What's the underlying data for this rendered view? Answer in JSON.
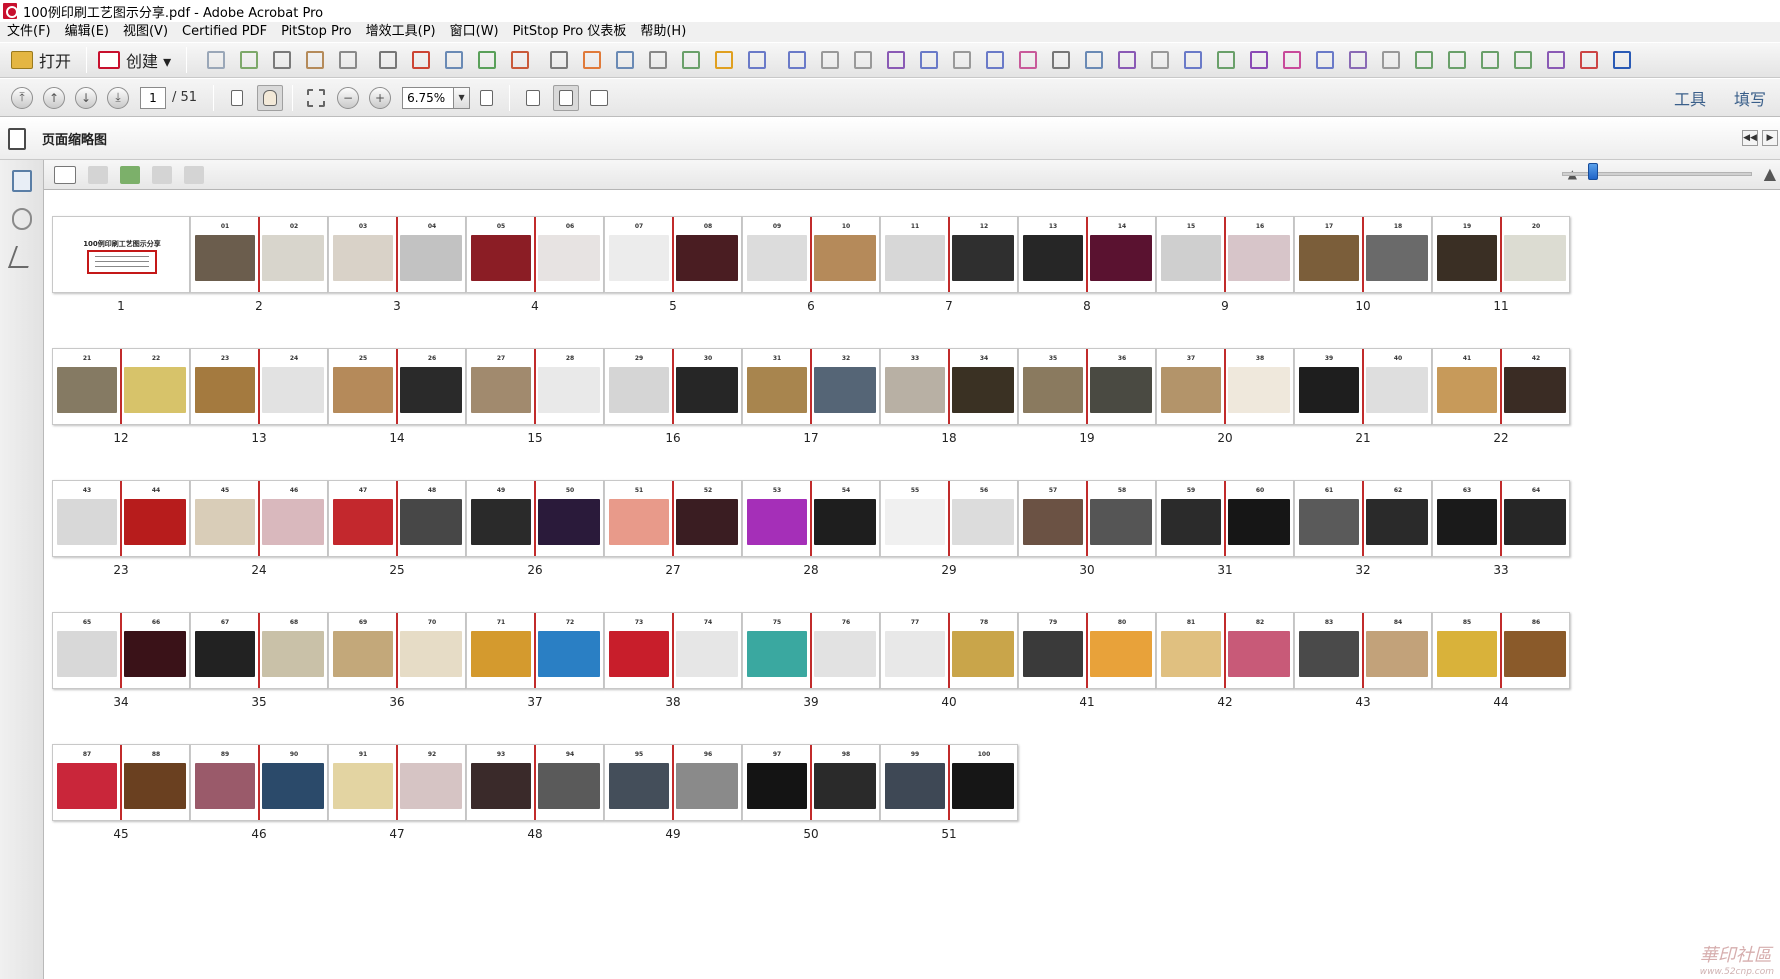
{
  "window": {
    "title": "100例印刷工艺图示分享.pdf - Adobe Acrobat Pro"
  },
  "menu": [
    "文件(F)",
    "编辑(E)",
    "视图(V)",
    "Certified PDF",
    "PitStop Pro",
    "增效工具(P)",
    "窗口(W)",
    "PitStop Pro 仪表板",
    "帮助(H)"
  ],
  "toolbar": {
    "open_label": "打开",
    "create_label": "创建 ▾",
    "icons": [
      "save-icon",
      "upload-icon",
      "print-icon",
      "edit-icon",
      "email-icon",
      "settings-icon",
      "pdf-delete-icon",
      "pdf-search-icon",
      "export-icon",
      "sign-icon",
      "print-setup-icon",
      "stamp-icon",
      "select-icon",
      "text-icon",
      "comment-icon",
      "color-bars-icon",
      "arrow-icon",
      "arrow-plus-icon",
      "crop-icon",
      "resize-icon",
      "preflight-icon",
      "move-icon",
      "split-icon",
      "annotate-icon",
      "link-icon",
      "screen-icon",
      "zoom-window-icon",
      "pin-icon",
      "ruler-icon",
      "list-icon",
      "checkbox-icon",
      "globe-icon",
      "gear-icon",
      "filter-icon",
      "funnel-icon",
      "grid-icon",
      "dots-icon",
      "hash-icon",
      "mail-x-icon",
      "pinwheel-icon",
      "warning-icon",
      "inspect-icon",
      "qs-icon"
    ]
  },
  "nav": {
    "current_page": "1",
    "total_pages": "/ 51",
    "zoom": "6.75%"
  },
  "right_tabs": [
    "工具",
    "填写"
  ],
  "panel": {
    "title": "页面缩略图"
  },
  "thumbnails": [
    {
      "label": "1",
      "cover": true,
      "cover_title": "100例印刷工艺图示分享"
    },
    {
      "label": "2",
      "h": [
        "01",
        "02"
      ],
      "c": [
        "#6b5d4d",
        "#d8d5cc"
      ]
    },
    {
      "label": "3",
      "h": [
        "03",
        "04"
      ],
      "c": [
        "#d9d2c8",
        "#c2c2c2"
      ]
    },
    {
      "label": "4",
      "h": [
        "05",
        "06"
      ],
      "c": [
        "#8b1d25",
        "#e7e3e2"
      ]
    },
    {
      "label": "5",
      "h": [
        "07",
        "08"
      ],
      "c": [
        "#ececec",
        "#4a1d22"
      ]
    },
    {
      "label": "6",
      "h": [
        "09",
        "10"
      ],
      "c": [
        "#dcdcdc",
        "#b58a5a"
      ]
    },
    {
      "label": "7",
      "h": [
        "11",
        "12"
      ],
      "c": [
        "#d7d7d7",
        "#2f2f2f"
      ]
    },
    {
      "label": "8",
      "h": [
        "13",
        "14"
      ],
      "c": [
        "#262626",
        "#5a1230"
      ]
    },
    {
      "label": "9",
      "h": [
        "15",
        "16"
      ],
      "c": [
        "#cfcfcf",
        "#d7c5c9"
      ]
    },
    {
      "label": "10",
      "h": [
        "17",
        "18"
      ],
      "c": [
        "#7b5e3a",
        "#6a6a6a"
      ]
    },
    {
      "label": "11",
      "h": [
        "19",
        "20"
      ],
      "c": [
        "#3a2f24",
        "#dcdcd2"
      ]
    },
    {
      "label": "12",
      "h": [
        "21",
        "22"
      ],
      "c": [
        "#857a63",
        "#d7c36a"
      ]
    },
    {
      "label": "13",
      "h": [
        "23",
        "24"
      ],
      "c": [
        "#a47a3f",
        "#e2e2e2"
      ]
    },
    {
      "label": "14",
      "h": [
        "25",
        "26"
      ],
      "c": [
        "#b58a5a",
        "#2a2a2a"
      ]
    },
    {
      "label": "15",
      "h": [
        "27",
        "28"
      ],
      "c": [
        "#a18a6e",
        "#e9e9e9"
      ]
    },
    {
      "label": "16",
      "h": [
        "29",
        "30"
      ],
      "c": [
        "#d5d5d5",
        "#262626"
      ]
    },
    {
      "label": "17",
      "h": [
        "31",
        "32"
      ],
      "c": [
        "#a8854e",
        "#556576"
      ]
    },
    {
      "label": "18",
      "h": [
        "33",
        "34"
      ],
      "c": [
        "#b8b0a4",
        "#3a3123"
      ]
    },
    {
      "label": "19",
      "h": [
        "35",
        "36"
      ],
      "c": [
        "#8a7a5f",
        "#4a4a42"
      ]
    },
    {
      "label": "20",
      "h": [
        "37",
        "38"
      ],
      "c": [
        "#b3946a",
        "#efe8dc"
      ]
    },
    {
      "label": "21",
      "h": [
        "39",
        "40"
      ],
      "c": [
        "#1e1e1e",
        "#dedede"
      ]
    },
    {
      "label": "22",
      "h": [
        "41",
        "42"
      ],
      "c": [
        "#c79a5a",
        "#3a2c24"
      ]
    },
    {
      "label": "23",
      "h": [
        "43",
        "44"
      ],
      "c": [
        "#d8d8d8",
        "#b71c1c"
      ]
    },
    {
      "label": "24",
      "h": [
        "45",
        "46"
      ],
      "c": [
        "#d9cdb8",
        "#d9b8bd"
      ]
    },
    {
      "label": "25",
      "h": [
        "47",
        "48"
      ],
      "c": [
        "#c3282d",
        "#474747"
      ]
    },
    {
      "label": "26",
      "h": [
        "49",
        "50"
      ],
      "c": [
        "#2a2a2a",
        "#2a1a3a"
      ]
    },
    {
      "label": "27",
      "h": [
        "51",
        "52"
      ],
      "c": [
        "#e89a8a",
        "#3a1d22"
      ]
    },
    {
      "label": "28",
      "h": [
        "53",
        "54"
      ],
      "c": [
        "#a52fb8",
        "#1e1e1e"
      ]
    },
    {
      "label": "29",
      "h": [
        "55",
        "56"
      ],
      "c": [
        "#f0f0f0",
        "#dcdcdc"
      ]
    },
    {
      "label": "30",
      "h": [
        "57",
        "58"
      ],
      "c": [
        "#6b5244",
        "#555555"
      ]
    },
    {
      "label": "31",
      "h": [
        "59",
        "60"
      ],
      "c": [
        "#2b2b2b",
        "#161616"
      ]
    },
    {
      "label": "32",
      "h": [
        "61",
        "62"
      ],
      "c": [
        "#5a5a5a",
        "#2a2a2a"
      ]
    },
    {
      "label": "33",
      "h": [
        "63",
        "64"
      ],
      "c": [
        "#1a1a1a",
        "#262626"
      ]
    },
    {
      "label": "34",
      "h": [
        "65",
        "66"
      ],
      "c": [
        "#d8d8d8",
        "#3a1218"
      ]
    },
    {
      "label": "35",
      "h": [
        "67",
        "68"
      ],
      "c": [
        "#222222",
        "#c9c1a8"
      ]
    },
    {
      "label": "36",
      "h": [
        "69",
        "70"
      ],
      "c": [
        "#c3a87a",
        "#e6dcc6"
      ]
    },
    {
      "label": "37",
      "h": [
        "71",
        "72"
      ],
      "c": [
        "#d49a2e",
        "#2a7fc4"
      ]
    },
    {
      "label": "38",
      "h": [
        "73",
        "74"
      ],
      "c": [
        "#c81e2b",
        "#e6e6e6"
      ]
    },
    {
      "label": "39",
      "h": [
        "75",
        "76"
      ],
      "c": [
        "#3aa8a0",
        "#e2e2e2"
      ]
    },
    {
      "label": "40",
      "h": [
        "77",
        "78"
      ],
      "c": [
        "#e8e8e8",
        "#c9a54a"
      ]
    },
    {
      "label": "41",
      "h": [
        "79",
        "80"
      ],
      "c": [
        "#3a3a3a",
        "#e8a23a"
      ]
    },
    {
      "label": "42",
      "h": [
        "81",
        "82"
      ],
      "c": [
        "#e0c080",
        "#c85a78"
      ]
    },
    {
      "label": "43",
      "h": [
        "83",
        "84"
      ],
      "c": [
        "#4a4a4a",
        "#c2a27a"
      ]
    },
    {
      "label": "44",
      "h": [
        "85",
        "86"
      ],
      "c": [
        "#d9b23a",
        "#8a5a2a"
      ]
    },
    {
      "label": "45",
      "h": [
        "87",
        "88"
      ],
      "c": [
        "#c9263a",
        "#6a4020"
      ]
    },
    {
      "label": "46",
      "h": [
        "89",
        "90"
      ],
      "c": [
        "#9a5a6a",
        "#2b4a6a"
      ]
    },
    {
      "label": "47",
      "h": [
        "91",
        "92"
      ],
      "c": [
        "#e3d4a2",
        "#d6c4c4"
      ]
    },
    {
      "label": "48",
      "h": [
        "93",
        "94"
      ],
      "c": [
        "#3a2a2a",
        "#5a5a5a"
      ]
    },
    {
      "label": "49",
      "h": [
        "95",
        "96"
      ],
      "c": [
        "#444e5a",
        "#8a8a8a"
      ]
    },
    {
      "label": "50",
      "h": [
        "97",
        "98"
      ],
      "c": [
        "#141414",
        "#2a2a2a"
      ]
    },
    {
      "label": "51",
      "h": [
        "99",
        "100"
      ],
      "c": [
        "#3e4855",
        "#161616"
      ]
    }
  ],
  "watermark": {
    "text": "華印社區",
    "url": "www.52cnp.com"
  }
}
